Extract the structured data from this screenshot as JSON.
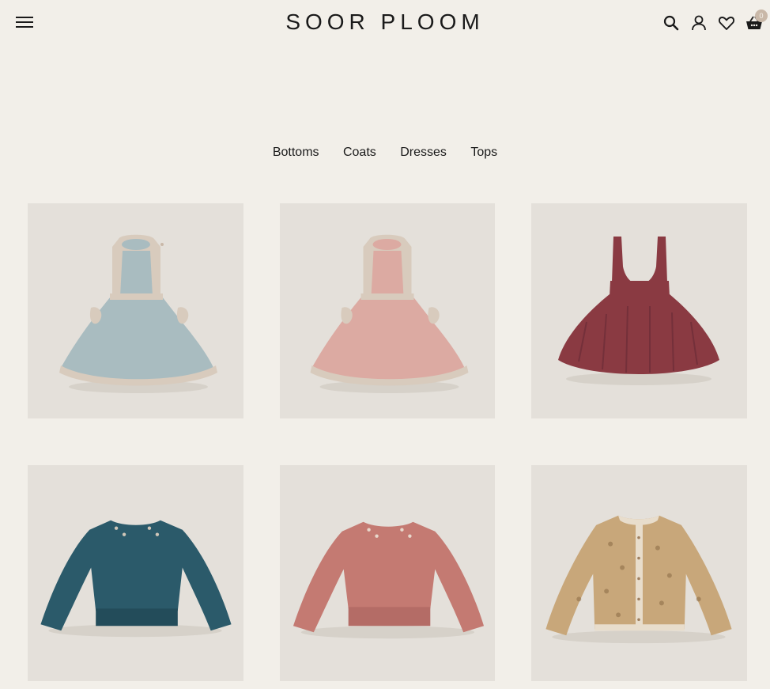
{
  "header": {
    "brand": "SOOR PLOOM",
    "menu_icon": "hamburger-menu-icon",
    "icons": [
      "search-icon",
      "account-icon",
      "heart-icon",
      "basket-icon"
    ],
    "cart_count": "0"
  },
  "categories": [
    "Bottoms",
    "Coats",
    "Dresses",
    "Tops"
  ],
  "products": [
    {
      "icon": "pinafore-dress-blue",
      "color": "#a9bcc0"
    },
    {
      "icon": "pinafore-dress-pink",
      "color": "#dcaaa2"
    },
    {
      "icon": "suspender-skirt-red",
      "color": "#8a3a42"
    },
    {
      "icon": "sweater-blue",
      "color": "#2b5a6a"
    },
    {
      "icon": "sweater-rose",
      "color": "#c47a72"
    },
    {
      "icon": "cardigan-floral",
      "color": "#c8a77a"
    }
  ],
  "colors": {
    "background": "#f2efe9",
    "tile": "#e4e0da",
    "text": "#1a1a1a",
    "badge": "#c9b8a8"
  }
}
